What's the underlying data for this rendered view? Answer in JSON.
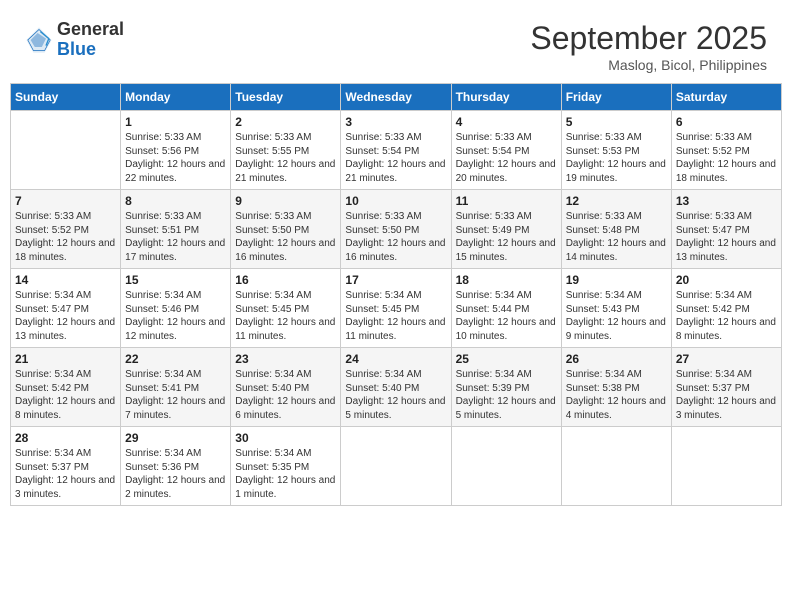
{
  "header": {
    "logo_general": "General",
    "logo_blue": "Blue",
    "month": "September 2025",
    "location": "Maslog, Bicol, Philippines"
  },
  "days_of_week": [
    "Sunday",
    "Monday",
    "Tuesday",
    "Wednesday",
    "Thursday",
    "Friday",
    "Saturday"
  ],
  "weeks": [
    [
      {
        "day": "",
        "info": ""
      },
      {
        "day": "1",
        "info": "Sunrise: 5:33 AM\nSunset: 5:56 PM\nDaylight: 12 hours\nand 22 minutes."
      },
      {
        "day": "2",
        "info": "Sunrise: 5:33 AM\nSunset: 5:55 PM\nDaylight: 12 hours\nand 21 minutes."
      },
      {
        "day": "3",
        "info": "Sunrise: 5:33 AM\nSunset: 5:54 PM\nDaylight: 12 hours\nand 21 minutes."
      },
      {
        "day": "4",
        "info": "Sunrise: 5:33 AM\nSunset: 5:54 PM\nDaylight: 12 hours\nand 20 minutes."
      },
      {
        "day": "5",
        "info": "Sunrise: 5:33 AM\nSunset: 5:53 PM\nDaylight: 12 hours\nand 19 minutes."
      },
      {
        "day": "6",
        "info": "Sunrise: 5:33 AM\nSunset: 5:52 PM\nDaylight: 12 hours\nand 18 minutes."
      }
    ],
    [
      {
        "day": "7",
        "info": "Sunrise: 5:33 AM\nSunset: 5:52 PM\nDaylight: 12 hours\nand 18 minutes."
      },
      {
        "day": "8",
        "info": "Sunrise: 5:33 AM\nSunset: 5:51 PM\nDaylight: 12 hours\nand 17 minutes."
      },
      {
        "day": "9",
        "info": "Sunrise: 5:33 AM\nSunset: 5:50 PM\nDaylight: 12 hours\nand 16 minutes."
      },
      {
        "day": "10",
        "info": "Sunrise: 5:33 AM\nSunset: 5:50 PM\nDaylight: 12 hours\nand 16 minutes."
      },
      {
        "day": "11",
        "info": "Sunrise: 5:33 AM\nSunset: 5:49 PM\nDaylight: 12 hours\nand 15 minutes."
      },
      {
        "day": "12",
        "info": "Sunrise: 5:33 AM\nSunset: 5:48 PM\nDaylight: 12 hours\nand 14 minutes."
      },
      {
        "day": "13",
        "info": "Sunrise: 5:33 AM\nSunset: 5:47 PM\nDaylight: 12 hours\nand 13 minutes."
      }
    ],
    [
      {
        "day": "14",
        "info": "Sunrise: 5:34 AM\nSunset: 5:47 PM\nDaylight: 12 hours\nand 13 minutes."
      },
      {
        "day": "15",
        "info": "Sunrise: 5:34 AM\nSunset: 5:46 PM\nDaylight: 12 hours\nand 12 minutes."
      },
      {
        "day": "16",
        "info": "Sunrise: 5:34 AM\nSunset: 5:45 PM\nDaylight: 12 hours\nand 11 minutes."
      },
      {
        "day": "17",
        "info": "Sunrise: 5:34 AM\nSunset: 5:45 PM\nDaylight: 12 hours\nand 11 minutes."
      },
      {
        "day": "18",
        "info": "Sunrise: 5:34 AM\nSunset: 5:44 PM\nDaylight: 12 hours\nand 10 minutes."
      },
      {
        "day": "19",
        "info": "Sunrise: 5:34 AM\nSunset: 5:43 PM\nDaylight: 12 hours\nand 9 minutes."
      },
      {
        "day": "20",
        "info": "Sunrise: 5:34 AM\nSunset: 5:42 PM\nDaylight: 12 hours\nand 8 minutes."
      }
    ],
    [
      {
        "day": "21",
        "info": "Sunrise: 5:34 AM\nSunset: 5:42 PM\nDaylight: 12 hours\nand 8 minutes."
      },
      {
        "day": "22",
        "info": "Sunrise: 5:34 AM\nSunset: 5:41 PM\nDaylight: 12 hours\nand 7 minutes."
      },
      {
        "day": "23",
        "info": "Sunrise: 5:34 AM\nSunset: 5:40 PM\nDaylight: 12 hours\nand 6 minutes."
      },
      {
        "day": "24",
        "info": "Sunrise: 5:34 AM\nSunset: 5:40 PM\nDaylight: 12 hours\nand 5 minutes."
      },
      {
        "day": "25",
        "info": "Sunrise: 5:34 AM\nSunset: 5:39 PM\nDaylight: 12 hours\nand 5 minutes."
      },
      {
        "day": "26",
        "info": "Sunrise: 5:34 AM\nSunset: 5:38 PM\nDaylight: 12 hours\nand 4 minutes."
      },
      {
        "day": "27",
        "info": "Sunrise: 5:34 AM\nSunset: 5:37 PM\nDaylight: 12 hours\nand 3 minutes."
      }
    ],
    [
      {
        "day": "28",
        "info": "Sunrise: 5:34 AM\nSunset: 5:37 PM\nDaylight: 12 hours\nand 3 minutes."
      },
      {
        "day": "29",
        "info": "Sunrise: 5:34 AM\nSunset: 5:36 PM\nDaylight: 12 hours\nand 2 minutes."
      },
      {
        "day": "30",
        "info": "Sunrise: 5:34 AM\nSunset: 5:35 PM\nDaylight: 12 hours\nand 1 minute."
      },
      {
        "day": "",
        "info": ""
      },
      {
        "day": "",
        "info": ""
      },
      {
        "day": "",
        "info": ""
      },
      {
        "day": "",
        "info": ""
      }
    ]
  ]
}
